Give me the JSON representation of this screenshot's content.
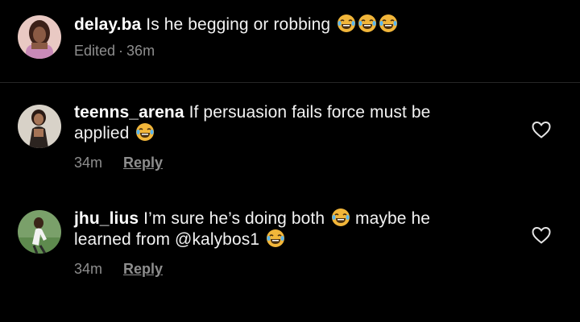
{
  "comments": [
    {
      "username": "delay.ba",
      "text": "Is he begging or robbing",
      "emoji_icon": "face-with-tears-of-joy",
      "emoji_count": 3,
      "meta_edited": "Edited",
      "meta_dot": "·",
      "time": "36m",
      "avatar_colors": [
        "#c9a48a",
        "#5a3a2e",
        "#e7c3b5"
      ]
    },
    {
      "username": "teenns_arena",
      "text_line1": "If persuasion fails force must be",
      "text_line2": "applied",
      "emoji_icon": "face-with-tears-of-joy",
      "time": "34m",
      "reply_label": "Reply",
      "like_icon": "heart-outline-icon"
    },
    {
      "username": "jhu_lius",
      "text_part1": "I’m sure he’s doing both",
      "text_part2": "maybe he",
      "text_line2": "learned from @kalybos1",
      "emoji_icon": "face-with-tears-of-joy",
      "time": "34m",
      "reply_label": "Reply",
      "like_icon": "heart-outline-icon"
    }
  ],
  "colors": {
    "background": "#000000",
    "text": "#f5f5f5",
    "muted": "#8e8e8e",
    "divider": "#262626"
  }
}
